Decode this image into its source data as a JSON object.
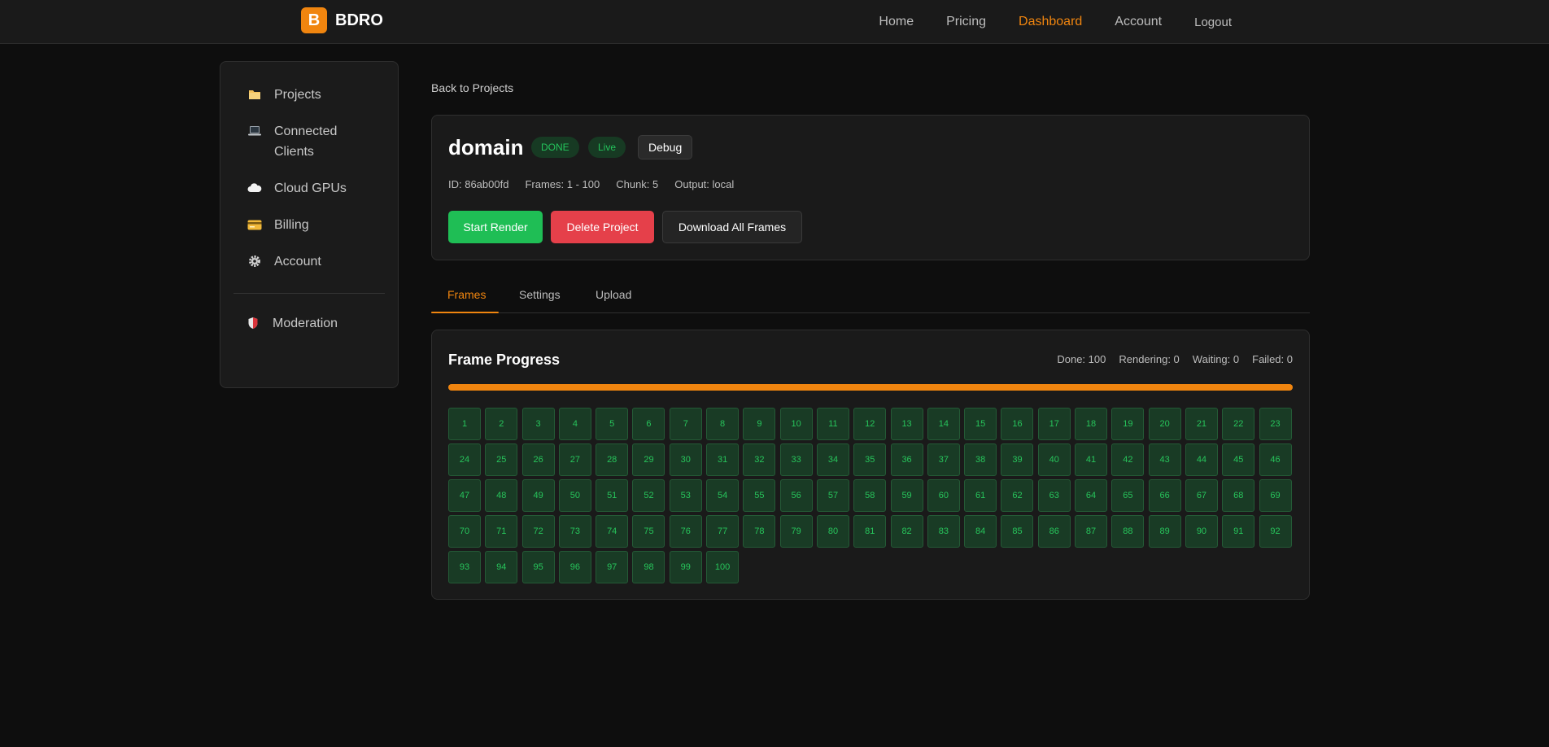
{
  "brand": {
    "mark": "B",
    "name": "BDRO",
    "accent": "#f0850f"
  },
  "nav": {
    "home": "Home",
    "pricing": "Pricing",
    "dashboard": "Dashboard",
    "account": "Account",
    "logout": "Logout"
  },
  "sidebar": {
    "items": [
      {
        "icon": "folder-icon",
        "label": "Projects"
      },
      {
        "icon": "laptop-icon",
        "label": "Connected Clients"
      },
      {
        "icon": "cloud-icon",
        "label": "Cloud GPUs"
      },
      {
        "icon": "credit-card-icon",
        "label": "Billing"
      },
      {
        "icon": "gear-icon",
        "label": "Account"
      },
      {
        "icon": "shield-icon",
        "label": "Moderation"
      }
    ]
  },
  "back_link": "Back to Projects",
  "project": {
    "title": "domain",
    "status_badge": "DONE",
    "live_badge": "Live",
    "debug_label": "Debug",
    "meta": {
      "id": "ID: 86ab00fd",
      "frames": "Frames: 1 - 100",
      "chunk": "Chunk: 5",
      "output": "Output: local"
    },
    "actions": {
      "start": "Start Render",
      "delete": "Delete Project",
      "download": "Download All Frames"
    }
  },
  "tabs": [
    "Frames",
    "Settings",
    "Upload"
  ],
  "progress": {
    "title": "Frame Progress",
    "stats": {
      "done": "Done: 100",
      "rendering": "Rendering: 0",
      "waiting": "Waiting: 0",
      "failed": "Failed: 0"
    },
    "percent": 100,
    "frame_count": 100,
    "frame_status": "done"
  }
}
